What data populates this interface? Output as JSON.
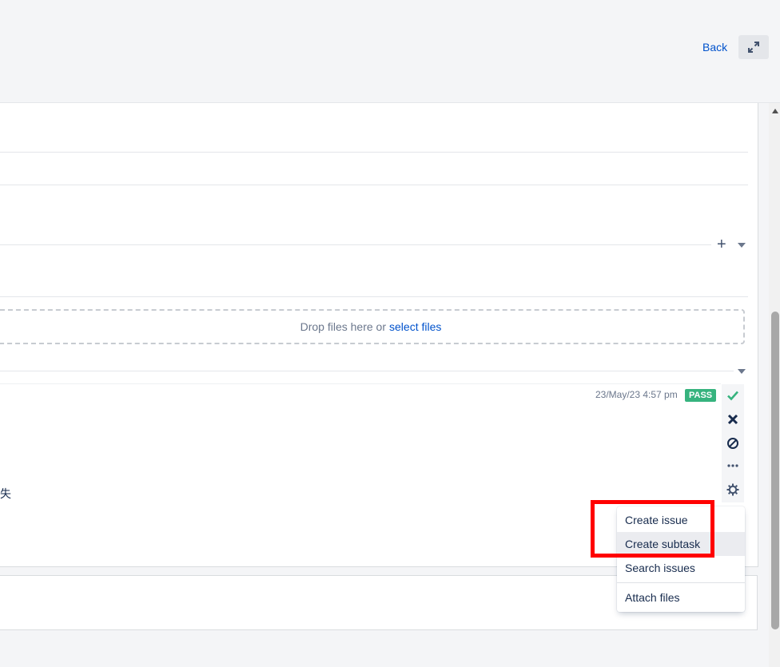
{
  "header": {
    "back_label": "Back",
    "expand_icon": "expand-arrows-icon"
  },
  "attachments": {
    "drop_text": "Drop files here or",
    "select_link": "select files"
  },
  "test_result": {
    "timestamp": "23/May/23 4:57 pm",
    "status": "PASS",
    "status_color": "#36b37e",
    "text_fragment": "失"
  },
  "actions": [
    {
      "name": "pass-check-icon",
      "color": "#36b37e"
    },
    {
      "name": "fail-x-icon",
      "color": "#172b4d"
    },
    {
      "name": "blocked-icon",
      "color": "#172b4d"
    },
    {
      "name": "more-ellipsis-icon",
      "color": "#42526e"
    },
    {
      "name": "settings-gear-icon",
      "color": "#42526e"
    }
  ],
  "dropdown": {
    "items": [
      "Create issue",
      "Create subtask",
      "Search issues",
      "Attach files"
    ],
    "hovered": "Create subtask"
  },
  "highlight_color": "#ff0000"
}
